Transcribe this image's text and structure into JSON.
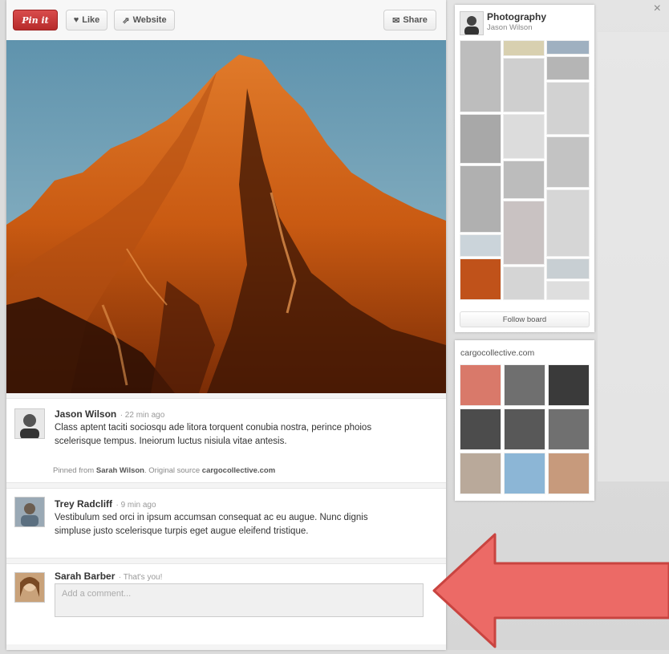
{
  "toolbar": {
    "pin_label": "Pin it",
    "like_label": "Like",
    "website_label": "Website",
    "share_label": "Share"
  },
  "close_label": "×",
  "comments": [
    {
      "name": "Jason Wilson",
      "time": "· 22 min ago",
      "text": "Class aptent taciti sociosqu ade litora torquent conubia nostra, perince phoios scelerisque tempus. Ineiorum luctus nisiula vitae antesis.",
      "meta_prefix": "Pinned from",
      "meta_user": "Sarah Wilson",
      "meta_mid": ". Original source",
      "meta_source": "cargocollective.com"
    },
    {
      "name": "Trey Radcliff",
      "time": "· 9 min ago",
      "text": "Vestibulum sed orci in ipsum accumsan consequat ac eu augue. Nunc dignis simpluse justo scelerisque turpis eget augue eleifend tristique."
    },
    {
      "name": "Sarah Barber",
      "time": "· That's you!",
      "placeholder": "Add a comment..."
    }
  ],
  "boards": {
    "photography": {
      "title": "Photography",
      "owner": "Jason Wilson",
      "follow_label": "Follow board"
    },
    "source": {
      "title": "cargocollective.com"
    }
  },
  "colors": {
    "pin_red": "#c53535",
    "arrow_fill": "#ec6a66",
    "arrow_stroke": "#c94440"
  }
}
